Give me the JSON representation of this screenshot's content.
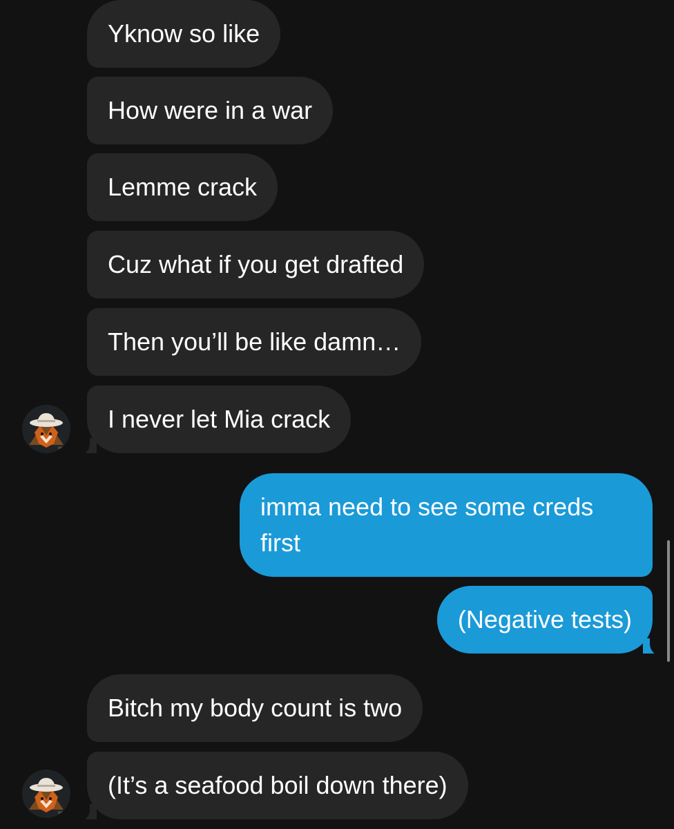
{
  "messages": [
    {
      "id": 1,
      "from": "them",
      "text": "Yknow so like"
    },
    {
      "id": 2,
      "from": "them",
      "text": "How were in a war"
    },
    {
      "id": 3,
      "from": "them",
      "text": "Lemme crack"
    },
    {
      "id": 4,
      "from": "them",
      "text": "Cuz what if you get drafted"
    },
    {
      "id": 5,
      "from": "them",
      "text": "Then you’ll be like damn…"
    },
    {
      "id": 6,
      "from": "them",
      "text": "I never let Mia crack"
    },
    {
      "id": 7,
      "from": "me",
      "text": "imma need to see some creds first"
    },
    {
      "id": 8,
      "from": "me",
      "text": "(Negative tests)"
    },
    {
      "id": 9,
      "from": "them",
      "text": "Bitch my body count is two"
    },
    {
      "id": 10,
      "from": "them",
      "text": "(It’s a seafood boil down there)"
    }
  ],
  "avatar": {
    "icon": "fox-cowboy-avatar-icon"
  },
  "colors": {
    "background": "#121212",
    "incoming_bubble": "#262626",
    "outgoing_bubble": "#1b9ad8",
    "text": "#ffffff"
  }
}
